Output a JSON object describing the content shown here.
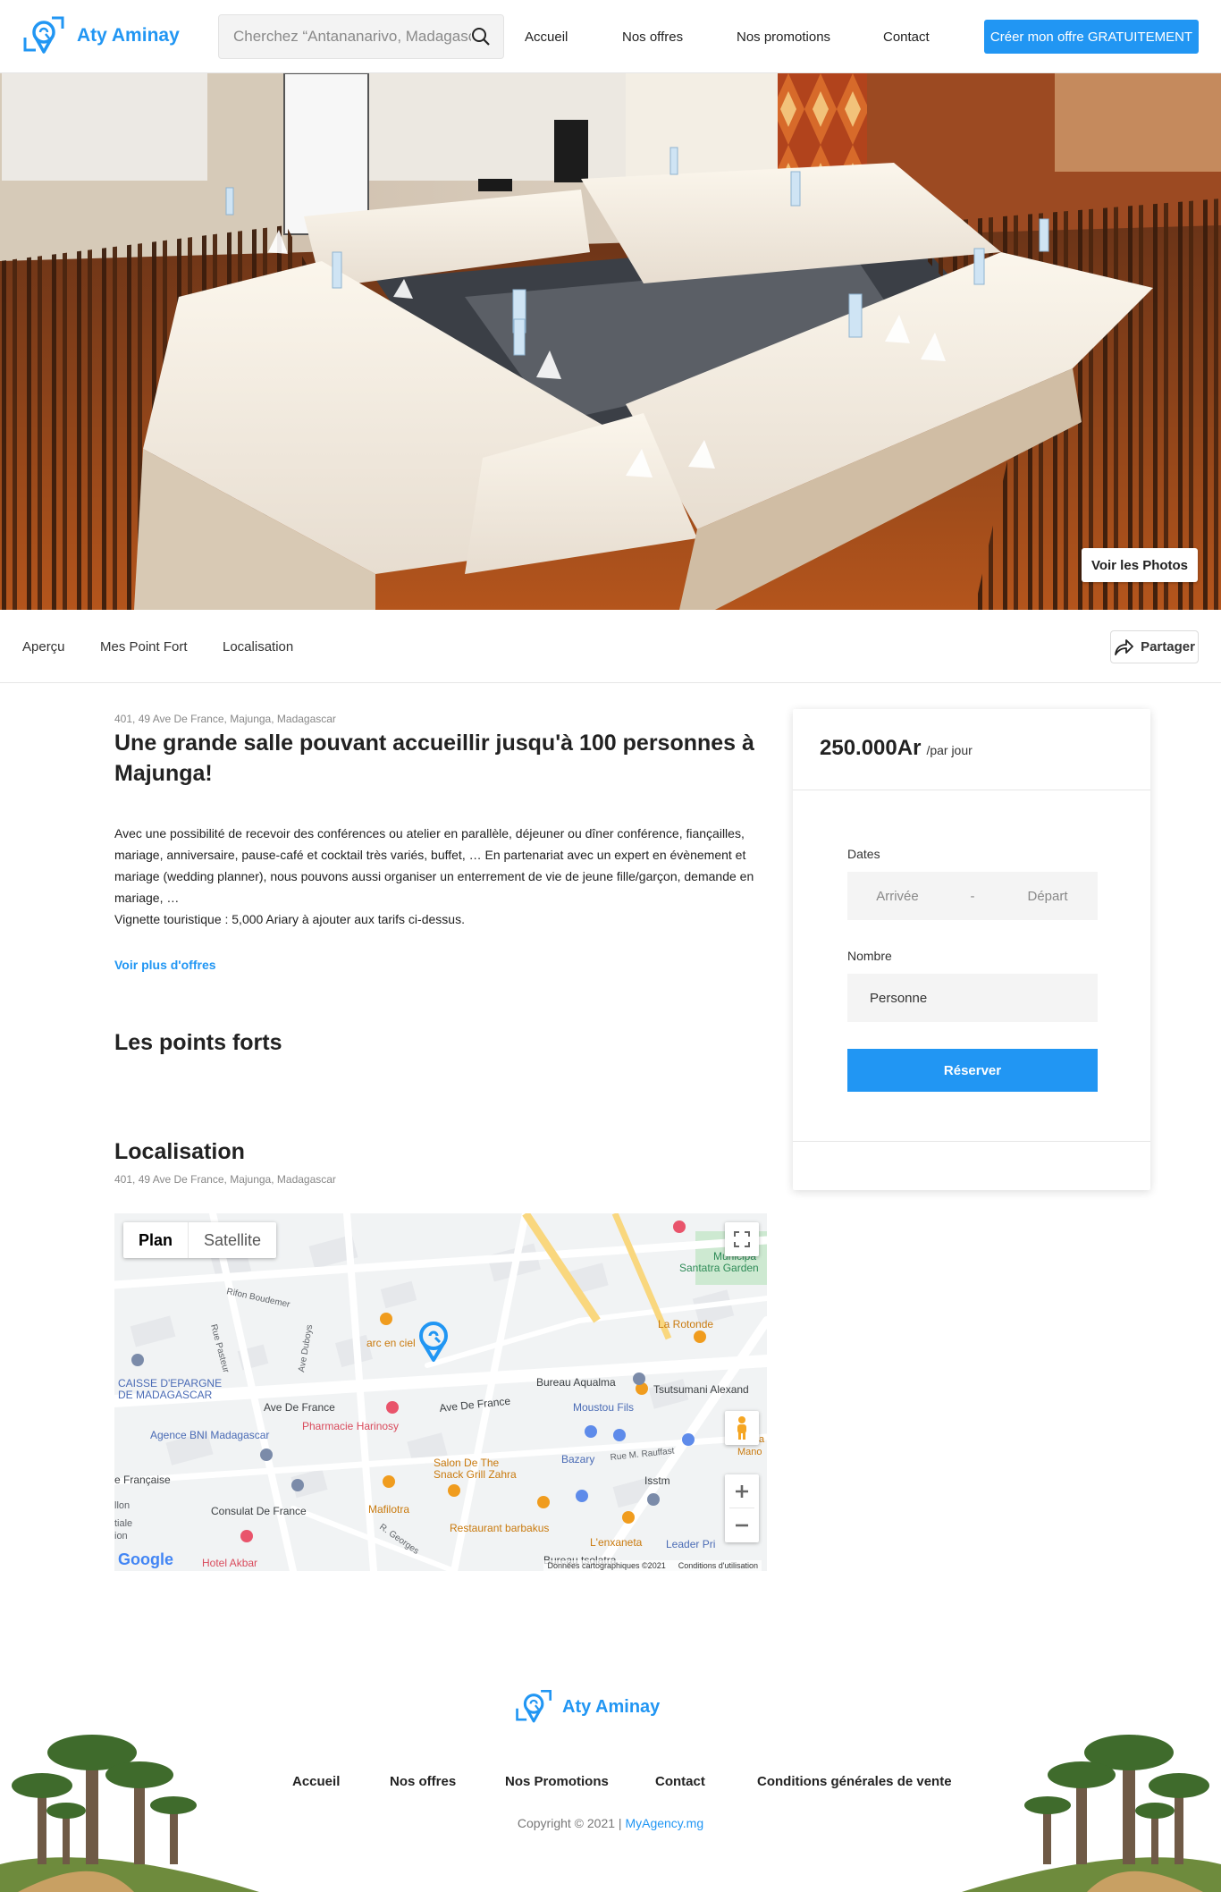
{
  "header": {
    "brand": "Aty Aminay",
    "search_placeholder": "Cherchez “Antananarivo, Madagascar”",
    "nav": [
      "Accueil",
      "Nos offres",
      "Nos promotions",
      "Contact"
    ],
    "cta": "Créer mon offre GRATUITEMENT"
  },
  "hero": {
    "photos_button": "Voir les Photos"
  },
  "tabs": {
    "items": [
      "Aperçu",
      "Mes Point Fort",
      "Localisation"
    ],
    "share": "Partager"
  },
  "listing": {
    "address": "401, 49 Ave De France, Majunga, Madagascar",
    "title": "Une grande salle pouvant accueillir jusqu'à 100 personnes à Majunga!",
    "description": "Avec une possibilité de recevoir des conférences ou atelier en parallèle, déjeuner ou dîner conférence, fiançailles, mariage, anniversaire, pause-café et cocktail très variés, buffet, … En partenariat avec un expert en évènement et mariage (wedding planner), nous pouvons aussi organiser un enterrement de vie de jeune fille/garçon, demande en mariage, …",
    "vignette": "Vignette touristique : 5,000 Ariary à ajouter aux tarifs ci-dessus.",
    "more_link": "Voir plus d'offres",
    "highlights_heading": "Les points forts",
    "location_heading": "Localisation"
  },
  "booking": {
    "price": "250.000Ar",
    "per": "/par jour",
    "dates_label": "Dates",
    "arrival": "Arrivée",
    "separator": "-",
    "departure": "Départ",
    "count_label": "Nombre",
    "count_placeholder": "Personne",
    "reserve": "Réserver"
  },
  "map": {
    "type_plan": "Plan",
    "type_satellite": "Satellite",
    "labels": {
      "rifon": "Rifon Boudemer",
      "arc": "arc en ciel",
      "rotonde": "La Rotonde",
      "municipal": "Municipa",
      "santatra": "Santatra Garden",
      "aqualma": "Bureau Aqualma",
      "tsutsumani": "Tsutsumani Alexand",
      "caisse1": "CAISSE D'EPARGNE",
      "caisse2": "DE MADAGASCAR",
      "ave1": "Ave De France",
      "ave2": "Ave De France",
      "moustou": "Moustou Fils",
      "pharmacie": "Pharmacie Harinosy",
      "bni": "Agence BNI Madagascar",
      "salon1": "Salon De The",
      "salon2": "Snack Grill Zahra",
      "bazary": "Bazary",
      "rauffast": "Rue M. Rauffast",
      "isstm": "Isstm",
      "francaise": "e Française",
      "consulat": "Consulat De France",
      "mafilotra": "Mafilotra",
      "barbakus": "Restaurant barbakus",
      "enxaneta": "L'enxaneta",
      "leader": "Leader Pri",
      "akbar": "Hotel Akbar",
      "bureau_bottom": "Bureau tsolatra",
      "rue_pasteur": "Rue Pasteur",
      "ave_duboys": "Ave Duboys",
      "georges": "R. Georges",
      "ilon": "llon",
      "tiale": "tiale",
      "ion": "ion",
      "mano": "Mano",
      "ta": "ta"
    },
    "google": "Google",
    "data_credit": "Données cartographiques ©2021",
    "terms": "Conditions d'utilisation"
  },
  "footer": {
    "brand": "Aty Aminay",
    "nav": [
      "Accueil",
      "Nos offres",
      "Nos Promotions",
      "Contact",
      "Conditions générales de vente"
    ],
    "copyright": "Copyright © 2021 |",
    "agency": "MyAgency.mg"
  },
  "colors": {
    "accent": "#2196f3"
  },
  "icons": [
    "logo-pin-icon",
    "search-icon",
    "share-icon",
    "fullscreen-icon",
    "zoom-in-icon",
    "zoom-out-icon",
    "pegman-icon",
    "map-marker-icon"
  ]
}
